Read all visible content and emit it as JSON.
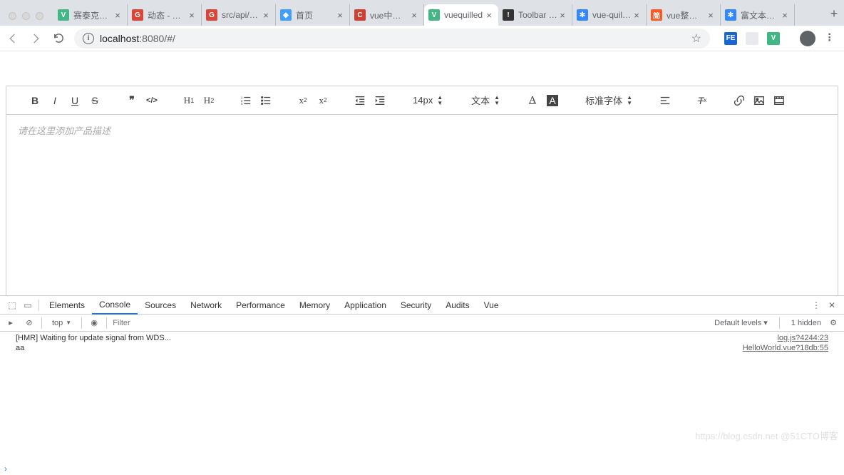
{
  "browser": {
    "tabs": [
      {
        "favColor": "#41b883",
        "favText": "V",
        "label": "赛泰克生物"
      },
      {
        "favColor": "#db4437",
        "favText": "G",
        "label": "动态 - 柴志"
      },
      {
        "favColor": "#db4437",
        "favText": "G",
        "label": "src/api/bas"
      },
      {
        "favColor": "#409eff",
        "favText": "◆",
        "label": "首页"
      },
      {
        "favColor": "#d23f31",
        "favText": "C",
        "label": "vue中使用v"
      },
      {
        "favColor": "#41b883",
        "favText": "V",
        "label": "vuequilled",
        "active": true
      },
      {
        "favColor": "#333",
        "favText": "!",
        "label": "Toolbar Mo"
      },
      {
        "favColor": "#3388ff",
        "favText": "✻",
        "label": "vue-quill-e"
      },
      {
        "favColor": "#ff5722",
        "favText": "简",
        "label": "vue整合qu"
      },
      {
        "favColor": "#3388ff",
        "favText": "✻",
        "label": "富文本编辑"
      }
    ],
    "url_host": "localhost",
    "url_rest": ":8080/#/",
    "ext_icons": [
      {
        "bg": "#1967d2",
        "t": "FE"
      },
      {
        "bg": "#e8eaed",
        "t": ""
      },
      {
        "bg": "#41b883",
        "t": "V"
      }
    ]
  },
  "editor": {
    "placeholder": "请在这里添加产品描述",
    "font_size": "14px",
    "text_label": "文本",
    "font_label": "标准字体"
  },
  "devtools": {
    "tabs": [
      "Elements",
      "Console",
      "Sources",
      "Network",
      "Performance",
      "Memory",
      "Application",
      "Security",
      "Audits",
      "Vue"
    ],
    "active_tab": "Console",
    "context": "top",
    "filter_ph": "Filter",
    "levels": "Default levels ▾",
    "hidden": "1 hidden",
    "logs": [
      {
        "msg": "[HMR] Waiting for update signal from WDS...",
        "src": "log.js?4244:23"
      },
      {
        "msg": "aa",
        "src": "HelloWorld.vue?18db:55"
      }
    ]
  },
  "watermark": "https://blog.csdn.net @51CTO博客"
}
